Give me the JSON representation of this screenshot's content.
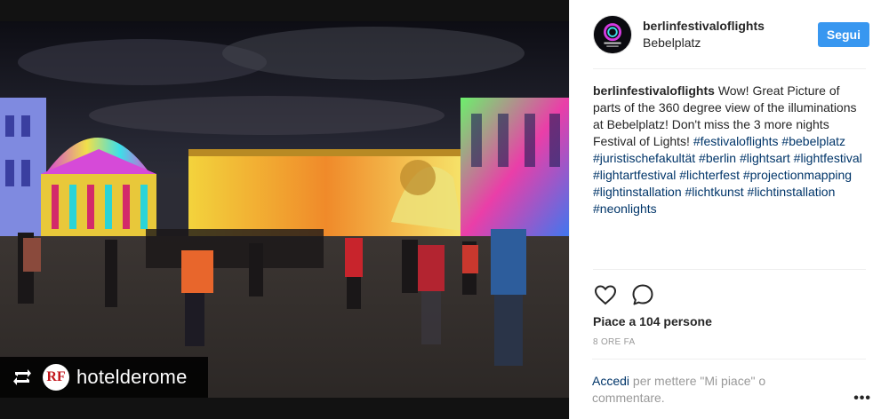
{
  "post": {
    "username": "berlinfestivaloflights",
    "location": "Bebelplatz",
    "follow_label": "Segui",
    "caption_text": "Wow! Great Picture of parts of the 360 degree view of the illuminations at Bebelplatz! Don't miss the 3 more nights Festival of Lights!",
    "hashtags": "#festivaloflights #bebelplatz #juristischefakultät #berlin #lightsart #lightfestival #lightartfestival #lichterfest #projectionmapping #lightinstallation #lichtkunst #lichtinstallation #neonlights",
    "likes": "Piace a 104 persone",
    "time": "8 ORE FA",
    "login_link": "Accedi",
    "login_text": " per mettere \"Mi piace\" o commentare.",
    "more_label": "•••"
  },
  "media": {
    "repost_handle": "hotelderome",
    "hotel_logo_text": "RF"
  },
  "icons": {
    "like": "heart-icon",
    "comment": "comment-icon",
    "repost": "repost-icon"
  },
  "colors": {
    "follow_button": "#3897f0",
    "link": "#003569",
    "muted": "#999999"
  }
}
